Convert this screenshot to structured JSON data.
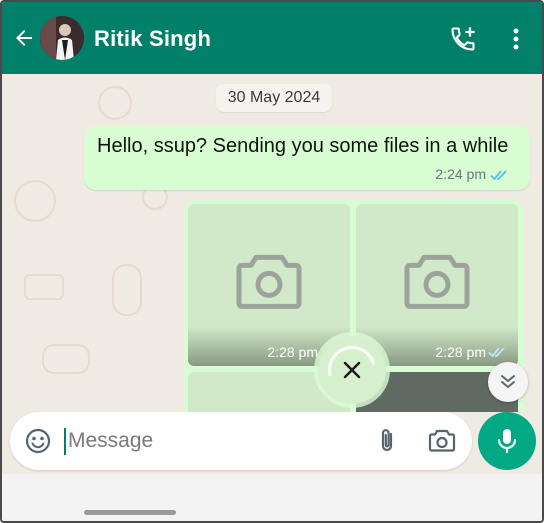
{
  "header": {
    "contact_name": "Ritik Singh",
    "back_icon": "arrow-left-icon",
    "call_icon": "add-call-icon",
    "menu_icon": "more-vertical-icon",
    "bar_color": "#008069"
  },
  "chat": {
    "date_chip": "30 May 2024",
    "messages": [
      {
        "text": "Hello, ssup? Sending you some files in a while",
        "time": "2:24 pm",
        "status": "read"
      }
    ],
    "media_group": {
      "items": [
        {
          "time": "2:28 pm",
          "icon": "camera-icon"
        },
        {
          "time": "2:28 pm",
          "icon": "camera-icon",
          "status": "sent"
        }
      ],
      "upload_icon": "close-icon"
    },
    "scroll_down_icon": "double-chevron-down-icon",
    "bubble_color": "#d9fdd3",
    "read_tick_color": "#53bdeb"
  },
  "composer": {
    "placeholder": "Message",
    "emoji_icon": "emoji-icon",
    "attach_icon": "paperclip-icon",
    "camera_icon": "camera-icon",
    "mic_icon": "mic-icon",
    "mic_color": "#00a884"
  }
}
